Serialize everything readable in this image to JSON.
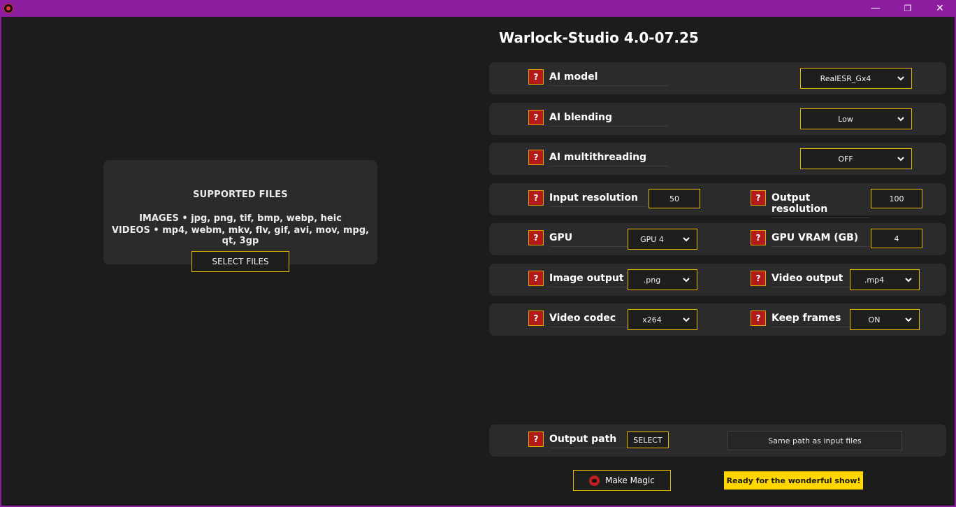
{
  "window": {
    "controls": {
      "minimize": "—",
      "maximize": "❐",
      "close": "✕"
    }
  },
  "app_title": "Warlock-Studio 4.0-07.25",
  "dropzone": {
    "title": "SUPPORTED FILES",
    "images_line": "IMAGES • jpg, png, tif, bmp, webp, heic",
    "videos_line": "VIDEOS • mp4, webm, mkv, flv, gif, avi, mov, mpg, qt, 3gp",
    "button_label": "SELECT FILES"
  },
  "help_glyph": "?",
  "settings": {
    "ai_model": {
      "label": "AI model",
      "value": "RealESR_Gx4"
    },
    "ai_blending": {
      "label": "AI blending",
      "value": "Low"
    },
    "ai_multithreading": {
      "label": "AI multithreading",
      "value": "OFF"
    },
    "input_resolution": {
      "label": "Input resolution",
      "value": "50"
    },
    "output_resolution": {
      "label": "Output resolution",
      "value": "100"
    },
    "gpu": {
      "label": "GPU",
      "value": "GPU 4"
    },
    "gpu_vram": {
      "label": "GPU VRAM (GB)",
      "value": "4"
    },
    "image_output": {
      "label": "Image output",
      "value": ".png"
    },
    "video_output": {
      "label": "Video output",
      "value": ".mp4"
    },
    "video_codec": {
      "label": "Video codec",
      "value": "x264"
    },
    "keep_frames": {
      "label": "Keep frames",
      "value": "ON"
    }
  },
  "output_path": {
    "label": "Output path",
    "button_label": "SELECT",
    "current": "Same path as input files"
  },
  "actions": {
    "make_magic": "Make Magic",
    "status": "Ready for the wonderful show!"
  },
  "colors": {
    "titlebar": "#8b1d9e",
    "accent_border": "#e5b800",
    "help_red": "#b31b1b",
    "status_yellow": "#ffd600",
    "panel": "#2b2b2b",
    "background": "#1c1c1c"
  }
}
